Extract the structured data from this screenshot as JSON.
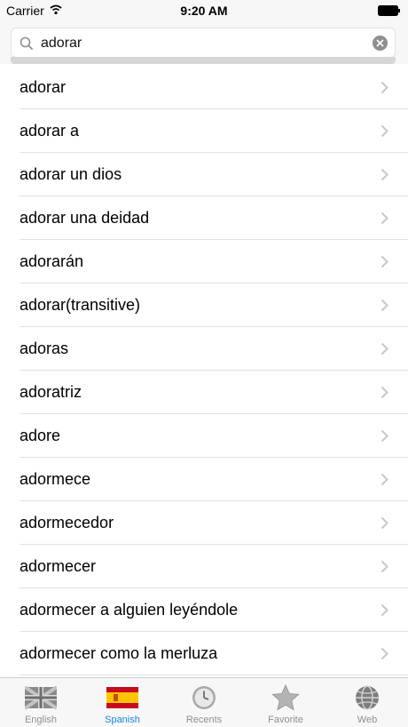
{
  "status_bar": {
    "carrier": "Carrier",
    "time": "9:20 AM"
  },
  "search": {
    "query": "adorar"
  },
  "results": [
    "adorar",
    "adorar a",
    "adorar un dios",
    "adorar una deidad",
    "adorarán",
    "adorar(transitive)",
    "adoras",
    "adoratriz",
    "adore",
    "adormece",
    "adormecedor",
    "adormecer",
    "adormecer a alguien leyéndole",
    "adormecer como la merluza"
  ],
  "tabs": [
    {
      "label": "English",
      "icon": "uk-flag-icon",
      "active": false
    },
    {
      "label": "Spanish",
      "icon": "spain-flag-icon",
      "active": true
    },
    {
      "label": "Recents",
      "icon": "clock-icon",
      "active": false
    },
    {
      "label": "Favorite",
      "icon": "star-icon",
      "active": false
    },
    {
      "label": "Web",
      "icon": "globe-icon",
      "active": false
    }
  ],
  "colors": {
    "active_tab": "#1a84d8",
    "inactive_tab": "#8f8f8f",
    "chevron": "#c7c7cc"
  }
}
